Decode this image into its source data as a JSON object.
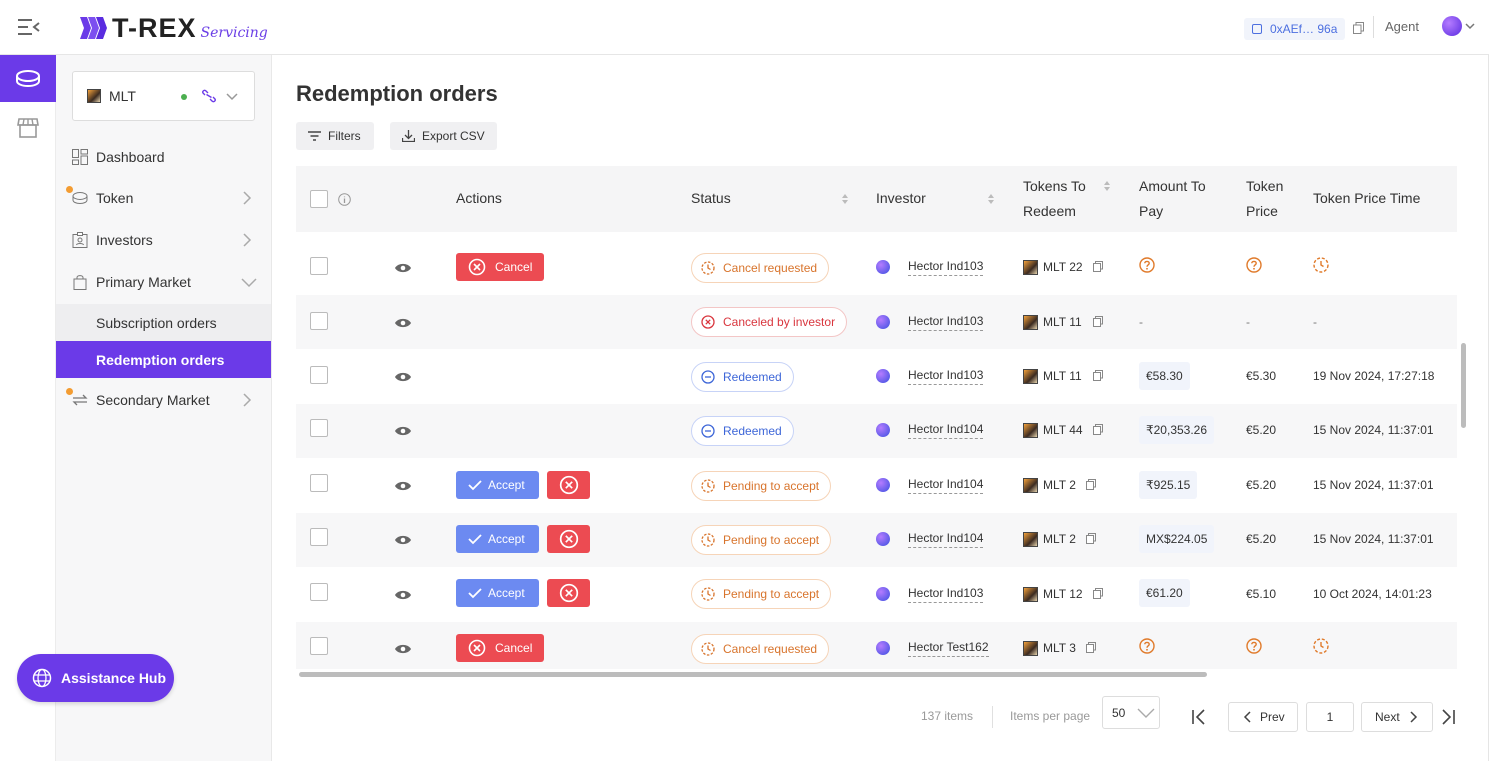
{
  "header": {
    "brand_name": "T-REX",
    "brand_sub": "Servicing",
    "wallet_address": "0xAEf… 96a",
    "role": "Agent",
    "colors": {
      "brand": "#6b3ae8",
      "accent_blue": "#4c6fe0"
    }
  },
  "sidebar": {
    "token_selector": {
      "value": "MLT",
      "status": "connected"
    },
    "items": [
      {
        "label": "Dashboard",
        "icon": "dashboard-icon"
      },
      {
        "label": "Token",
        "icon": "coins-icon"
      },
      {
        "label": "Investors",
        "icon": "id-card-icon"
      },
      {
        "label": "Primary Market",
        "icon": "shopping-bag-icon"
      },
      {
        "label": "Subscription orders"
      },
      {
        "label": "Redemption orders"
      },
      {
        "label": "Secondary Market",
        "icon": "swap-icon"
      }
    ],
    "assist_label": "Assistance Hub"
  },
  "page": {
    "title": "Redemption orders",
    "filters_label": "Filters",
    "export_label": "Export CSV"
  },
  "table": {
    "headers": {
      "actions": "Actions",
      "status": "Status",
      "investor": "Investor",
      "tokens_line1": "Tokens To",
      "tokens_line2": "Redeem",
      "amount_line1": "Amount To",
      "amount_line2": "Pay",
      "price_line1": "Token",
      "price_line2": "Price",
      "price_time": "Token Price Time"
    },
    "labels": {
      "cancel": "Cancel",
      "accept": "Accept"
    },
    "rows": [
      {
        "action": "cancel",
        "status": "Cancel requested",
        "status_kind": "orange",
        "investor": "Hector Ind103",
        "tokens": "MLT 22",
        "amount": "",
        "price": "",
        "time": "",
        "unknown": true
      },
      {
        "action": "none",
        "status": "Canceled by investor",
        "status_kind": "red",
        "investor": "Hector Ind103",
        "tokens": "MLT 11",
        "amount": "-",
        "price": "-",
        "time": "-"
      },
      {
        "action": "none",
        "status": "Redeemed",
        "status_kind": "blue",
        "investor": "Hector Ind103",
        "tokens": "MLT 11",
        "amount": "€58.30",
        "price": "€5.30",
        "time": "19 Nov 2024, 17:27:18"
      },
      {
        "action": "none",
        "status": "Redeemed",
        "status_kind": "blue",
        "investor": "Hector Ind104",
        "tokens": "MLT 44",
        "amount": "₹20,353.26",
        "price": "€5.20",
        "time": "15 Nov 2024, 11:37:01"
      },
      {
        "action": "accept",
        "status": "Pending to accept",
        "status_kind": "orange",
        "investor": "Hector Ind104",
        "tokens": "MLT 2",
        "amount": "₹925.15",
        "price": "€5.20",
        "time": "15 Nov 2024, 11:37:01"
      },
      {
        "action": "accept",
        "status": "Pending to accept",
        "status_kind": "orange",
        "investor": "Hector Ind104",
        "tokens": "MLT 2",
        "amount": "MX$224.05",
        "price": "€5.20",
        "time": "15 Nov 2024, 11:37:01"
      },
      {
        "action": "accept",
        "status": "Pending to accept",
        "status_kind": "orange",
        "investor": "Hector Ind103",
        "tokens": "MLT 12",
        "amount": "€61.20",
        "price": "€5.10",
        "time": "10 Oct 2024, 14:01:23"
      },
      {
        "action": "cancel",
        "status": "Cancel requested",
        "status_kind": "orange",
        "investor": "Hector Test162",
        "tokens": "MLT 3",
        "amount": "",
        "price": "",
        "time": "",
        "unknown": true
      }
    ]
  },
  "pagination": {
    "total": "137 items",
    "per_page_label": "Items per page",
    "per_page": "50",
    "prev": "Prev",
    "page": "1",
    "next": "Next"
  }
}
